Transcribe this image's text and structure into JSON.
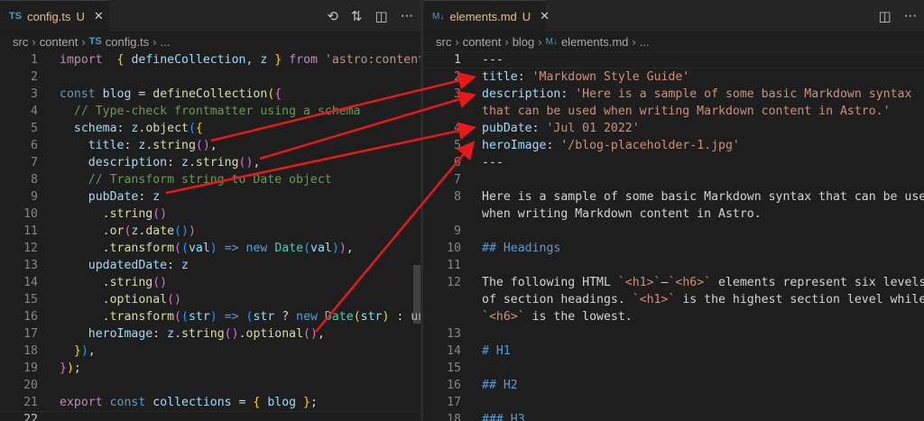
{
  "left": {
    "tab": {
      "icon": "TS",
      "title": "config.ts",
      "status": "U",
      "close": "✕"
    },
    "actions": [
      {
        "name": "timeline-icon",
        "glyph": "⟲"
      },
      {
        "name": "source-control-icon",
        "glyph": "⇅"
      },
      {
        "name": "split-editor-icon",
        "glyph": "◫"
      },
      {
        "name": "more-actions-icon",
        "glyph": "···"
      }
    ],
    "breadcrumb": [
      "src",
      "content",
      "config.ts",
      "..."
    ],
    "breadcrumb_icon": "TS",
    "lines": [
      {
        "n": "1",
        "t": [
          [
            "kw2",
            "import"
          ],
          [
            "",
            "  "
          ],
          [
            "br1",
            "{"
          ],
          [
            "",
            " "
          ],
          [
            "var",
            "defineCollection"
          ],
          [
            "",
            ", "
          ],
          [
            "var",
            "z"
          ],
          [
            "",
            " "
          ],
          [
            "br1",
            "}"
          ],
          [
            "",
            " "
          ],
          [
            "kw2",
            "from"
          ],
          [
            "",
            " "
          ],
          [
            "str",
            "'astro:content'"
          ],
          [
            "",
            ";"
          ]
        ]
      },
      {
        "n": "2",
        "t": []
      },
      {
        "n": "3",
        "t": [
          [
            "kw",
            "const"
          ],
          [
            "",
            " "
          ],
          [
            "var",
            "blog"
          ],
          [
            "",
            " = "
          ],
          [
            "fn",
            "defineCollection"
          ],
          [
            "br1",
            "("
          ],
          [
            "br2",
            "{"
          ]
        ]
      },
      {
        "n": "4",
        "t": [
          [
            "",
            "  "
          ],
          [
            "cm",
            "// Type-check frontmatter using a schema"
          ]
        ]
      },
      {
        "n": "5",
        "t": [
          [
            "",
            "  "
          ],
          [
            "var",
            "schema"
          ],
          [
            "",
            ": "
          ],
          [
            "var",
            "z"
          ],
          [
            "",
            "."
          ],
          [
            "fn",
            "object"
          ],
          [
            "br3",
            "("
          ],
          [
            "br1",
            "{"
          ]
        ]
      },
      {
        "n": "6",
        "t": [
          [
            "",
            "    "
          ],
          [
            "var",
            "title"
          ],
          [
            "",
            ": "
          ],
          [
            "var",
            "z"
          ],
          [
            "",
            "."
          ],
          [
            "fn",
            "string"
          ],
          [
            "br2",
            "()"
          ],
          [
            "",
            ","
          ]
        ]
      },
      {
        "n": "7",
        "t": [
          [
            "",
            "    "
          ],
          [
            "var",
            "description"
          ],
          [
            "",
            ": "
          ],
          [
            "var",
            "z"
          ],
          [
            "",
            "."
          ],
          [
            "fn",
            "string"
          ],
          [
            "br2",
            "()"
          ],
          [
            "",
            ","
          ]
        ]
      },
      {
        "n": "8",
        "t": [
          [
            "",
            "    "
          ],
          [
            "cm",
            "// Transform string to Date object"
          ]
        ]
      },
      {
        "n": "9",
        "t": [
          [
            "",
            "    "
          ],
          [
            "var",
            "pubDate"
          ],
          [
            "",
            ": "
          ],
          [
            "var",
            "z"
          ]
        ]
      },
      {
        "n": "10",
        "t": [
          [
            "",
            "      ."
          ],
          [
            "fn",
            "string"
          ],
          [
            "br2",
            "()"
          ]
        ]
      },
      {
        "n": "11",
        "t": [
          [
            "",
            "      ."
          ],
          [
            "fn",
            "or"
          ],
          [
            "br2",
            "("
          ],
          [
            "var",
            "z"
          ],
          [
            "",
            "."
          ],
          [
            "fn",
            "date"
          ],
          [
            "br3",
            "()"
          ],
          [
            "br2",
            ")"
          ]
        ]
      },
      {
        "n": "12",
        "t": [
          [
            "",
            "      ."
          ],
          [
            "fn",
            "transform"
          ],
          [
            "br2",
            "("
          ],
          [
            "br3",
            "("
          ],
          [
            "var",
            "val"
          ],
          [
            "br3",
            ")"
          ],
          [
            "",
            " "
          ],
          [
            "kw",
            "=>"
          ],
          [
            "",
            " "
          ],
          [
            "kw",
            "new"
          ],
          [
            "",
            " "
          ],
          [
            "cls",
            "Date"
          ],
          [
            "br3",
            "("
          ],
          [
            "var",
            "val"
          ],
          [
            "br3",
            ")"
          ],
          [
            "br2",
            ")"
          ],
          [
            "",
            ","
          ]
        ]
      },
      {
        "n": "13",
        "t": [
          [
            "",
            "    "
          ],
          [
            "var",
            "updatedDate"
          ],
          [
            "",
            ": "
          ],
          [
            "var",
            "z"
          ]
        ]
      },
      {
        "n": "14",
        "t": [
          [
            "",
            "      ."
          ],
          [
            "fn",
            "string"
          ],
          [
            "br2",
            "()"
          ]
        ]
      },
      {
        "n": "15",
        "t": [
          [
            "",
            "      ."
          ],
          [
            "fn",
            "optional"
          ],
          [
            "br2",
            "()"
          ]
        ]
      },
      {
        "n": "16",
        "t": [
          [
            "",
            "      ."
          ],
          [
            "fn",
            "transform"
          ],
          [
            "br2",
            "("
          ],
          [
            "br3",
            "("
          ],
          [
            "var",
            "str"
          ],
          [
            "br3",
            ")"
          ],
          [
            "",
            " "
          ],
          [
            "kw",
            "=>"
          ],
          [
            "",
            " "
          ],
          [
            "br3",
            "("
          ],
          [
            "var",
            "str"
          ],
          [
            "",
            " ? "
          ],
          [
            "kw",
            "new"
          ],
          [
            "",
            " "
          ],
          [
            "cls",
            "Date"
          ],
          [
            "br1",
            "("
          ],
          [
            "var",
            "str"
          ],
          [
            "br1",
            ")"
          ],
          [
            "",
            " : "
          ],
          [
            "var",
            "unde"
          ]
        ]
      },
      {
        "n": "17",
        "t": [
          [
            "",
            "    "
          ],
          [
            "var",
            "heroImage"
          ],
          [
            "",
            ": "
          ],
          [
            "var",
            "z"
          ],
          [
            "",
            "."
          ],
          [
            "fn",
            "string"
          ],
          [
            "br2",
            "()"
          ],
          [
            "",
            "."
          ],
          [
            "fn",
            "optional"
          ],
          [
            "br2",
            "()"
          ],
          [
            "",
            ","
          ]
        ]
      },
      {
        "n": "18",
        "t": [
          [
            "",
            "  "
          ],
          [
            "br1",
            "}"
          ],
          [
            "br3",
            ")"
          ],
          [
            "",
            ","
          ]
        ]
      },
      {
        "n": "19",
        "t": [
          [
            "br2",
            "}"
          ],
          [
            "br1",
            ")"
          ],
          [
            "",
            ";"
          ]
        ]
      },
      {
        "n": "20",
        "t": []
      },
      {
        "n": "21",
        "t": [
          [
            "kw2",
            "export"
          ],
          [
            "",
            " "
          ],
          [
            "kw",
            "const"
          ],
          [
            "",
            " "
          ],
          [
            "var",
            "collections"
          ],
          [
            "",
            " = "
          ],
          [
            "br1",
            "{"
          ],
          [
            "",
            " "
          ],
          [
            "var",
            "blog"
          ],
          [
            "",
            " "
          ],
          [
            "br1",
            "}"
          ],
          [
            "",
            ";"
          ]
        ]
      },
      {
        "n": "22",
        "t": [],
        "current": true
      }
    ]
  },
  "right": {
    "tab": {
      "icon": "M↓",
      "title": "elements.md",
      "status": "U",
      "close": "✕"
    },
    "actions": [
      {
        "name": "split-editor-icon",
        "glyph": "◫"
      },
      {
        "name": "more-actions-icon",
        "glyph": "···"
      }
    ],
    "breadcrumb": [
      "src",
      "content",
      "blog",
      "elements.md",
      "..."
    ],
    "breadcrumb_icon": "M↓",
    "lines": [
      {
        "n": "1",
        "t": [
          [
            "",
            "---"
          ]
        ],
        "current": true
      },
      {
        "n": "2",
        "t": [
          [
            "var",
            "title"
          ],
          [
            "",
            ": "
          ],
          [
            "str",
            "'Markdown Style Guide'"
          ]
        ]
      },
      {
        "n": "3",
        "t": [
          [
            "var",
            "description"
          ],
          [
            "",
            ": "
          ],
          [
            "str",
            "'Here is a sample of some basic Markdown syntax"
          ]
        ]
      },
      {
        "n": "",
        "t": [
          [
            "str",
            "that can be used when writing Markdown content in Astro.'"
          ]
        ]
      },
      {
        "n": "4",
        "t": [
          [
            "var",
            "pubDate"
          ],
          [
            "",
            ": "
          ],
          [
            "str",
            "'Jul 01 2022'"
          ]
        ]
      },
      {
        "n": "5",
        "t": [
          [
            "var",
            "heroImage"
          ],
          [
            "",
            ": "
          ],
          [
            "str",
            "'/blog-placeholder-1.jpg'"
          ]
        ]
      },
      {
        "n": "6",
        "t": [
          [
            "",
            "---"
          ]
        ]
      },
      {
        "n": "7",
        "t": []
      },
      {
        "n": "8",
        "t": [
          [
            "",
            "Here is a sample of some basic Markdown syntax that can be used"
          ]
        ]
      },
      {
        "n": "",
        "t": [
          [
            "",
            "when writing Markdown content in Astro."
          ]
        ]
      },
      {
        "n": "9",
        "t": []
      },
      {
        "n": "10",
        "t": [
          [
            "mdh",
            "## Headings"
          ]
        ]
      },
      {
        "n": "11",
        "t": []
      },
      {
        "n": "12",
        "t": [
          [
            "",
            "The following HTML "
          ],
          [
            "str",
            "`<h1>`"
          ],
          [
            "",
            "—"
          ],
          [
            "str",
            "`<h6>`"
          ],
          [
            "",
            " elements represent six levels"
          ]
        ]
      },
      {
        "n": "",
        "t": [
          [
            "",
            "of section headings. "
          ],
          [
            "str",
            "`<h1>`"
          ],
          [
            "",
            " is the highest section level while"
          ]
        ]
      },
      {
        "n": "",
        "t": [
          [
            "str",
            "`<h6>`"
          ],
          [
            "",
            " is the lowest."
          ]
        ]
      },
      {
        "n": "13",
        "t": []
      },
      {
        "n": "14",
        "t": [
          [
            "mdh",
            "# H1"
          ]
        ]
      },
      {
        "n": "15",
        "t": []
      },
      {
        "n": "16",
        "t": [
          [
            "mdh",
            "## H2"
          ]
        ]
      },
      {
        "n": "17",
        "t": []
      },
      {
        "n": "18",
        "t": [
          [
            "mdh",
            "### H3"
          ]
        ]
      }
    ]
  },
  "colors": {
    "arrow": "#e8191b",
    "modified": "#e2c08d",
    "ts_icon": "#519aba"
  }
}
